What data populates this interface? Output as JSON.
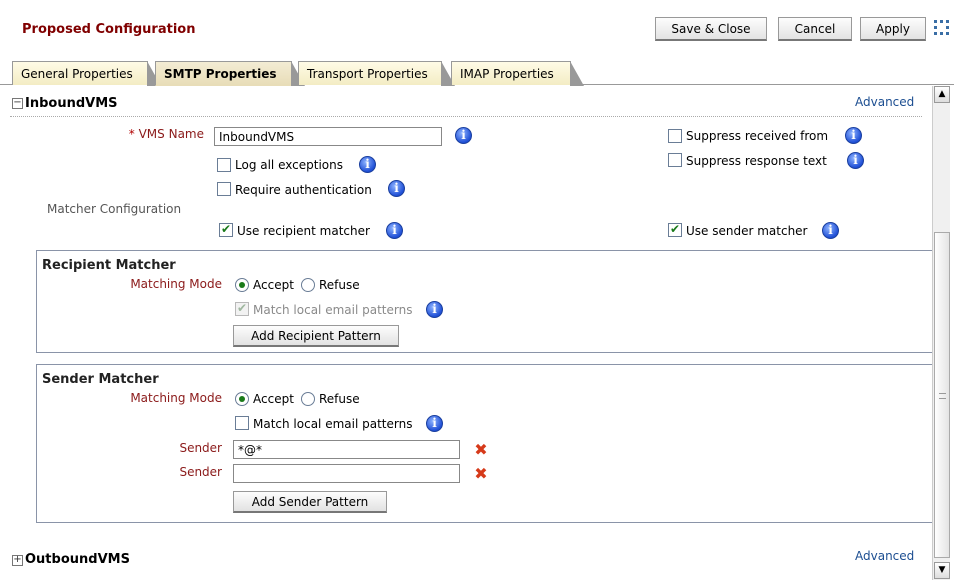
{
  "header": {
    "title": "Proposed Configuration",
    "save_close": "Save & Close",
    "cancel": "Cancel",
    "apply": "Apply"
  },
  "tabs": [
    {
      "label": "General Properties",
      "active": false
    },
    {
      "label": "SMTP Properties",
      "active": true
    },
    {
      "label": "Transport Properties",
      "active": false
    },
    {
      "label": "IMAP Properties",
      "active": false
    }
  ],
  "inbound": {
    "title": "InboundVMS",
    "expanded": true,
    "advanced": "Advanced",
    "required_mark": "*",
    "vms_name_label": "VMS Name",
    "vms_name_value": "InboundVMS",
    "log_all_exceptions": {
      "label": "Log all exceptions",
      "checked": false
    },
    "require_authentication": {
      "label": "Require authentication",
      "checked": false
    },
    "suppress_received_from": {
      "label": "Suppress received from",
      "checked": false
    },
    "suppress_response_text": {
      "label": "Suppress response text",
      "checked": false
    },
    "matcher_configuration_label": "Matcher Configuration",
    "use_recipient_matcher": {
      "label": "Use recipient matcher",
      "checked": true
    },
    "use_sender_matcher": {
      "label": "Use sender matcher",
      "checked": true
    }
  },
  "recipient_matcher": {
    "title": "Recipient Matcher",
    "matching_mode_label": "Matching Mode",
    "accept": "Accept",
    "refuse": "Refuse",
    "selected": "Accept",
    "match_local": {
      "label": "Match local email patterns",
      "checked": true,
      "disabled": true
    },
    "add_button": "Add Recipient Pattern"
  },
  "sender_matcher": {
    "title": "Sender Matcher",
    "matching_mode_label": "Matching Mode",
    "accept": "Accept",
    "refuse": "Refuse",
    "selected": "Accept",
    "match_local": {
      "label": "Match local email patterns",
      "checked": false,
      "disabled": false
    },
    "senders": [
      {
        "label": "Sender",
        "value": "*@*"
      },
      {
        "label": "Sender",
        "value": ""
      }
    ],
    "add_button": "Add Sender Pattern"
  },
  "outbound": {
    "title": "OutboundVMS",
    "expanded": false,
    "advanced": "Advanced"
  },
  "icons": {
    "info": "info-icon",
    "delete": "delete-icon",
    "expand": "plus-icon",
    "collapse": "minus-icon"
  },
  "colors": {
    "title_red": "#800000",
    "label_red": "#8b1a1a",
    "link_blue": "#1c4e91",
    "info_blue": "#1f4fd6",
    "delete_red": "#d63a1a",
    "tab_bg": "#f3ecc4"
  }
}
